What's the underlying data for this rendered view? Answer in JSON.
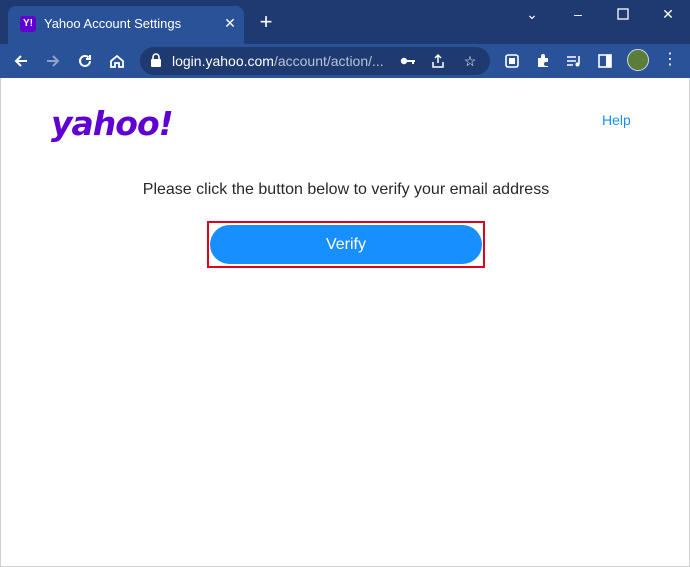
{
  "browser": {
    "tab_title": "Yahoo Account Settings",
    "favicon_label": "Y!",
    "url_host": "login.yahoo.com",
    "url_path": "/account/action/..."
  },
  "page": {
    "logo_text": "yahoo!",
    "help_label": "Help",
    "message": "Please click the button below to verify your email address",
    "verify_label": "Verify"
  },
  "colors": {
    "brand": "#6001d2",
    "button": "#188fff",
    "highlight": "#e0001b",
    "chrome_tabstrip": "#1e3a70",
    "chrome_toolbar": "#2a5299"
  }
}
